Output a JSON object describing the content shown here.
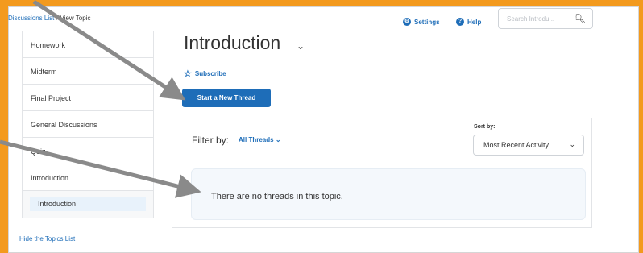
{
  "breadcrumb": {
    "link": "Discussions List",
    "sep": "›",
    "current": "View Topic"
  },
  "header": {
    "settings_label": "Settings",
    "help_label": "Help",
    "search_placeholder": "Search Introdu..."
  },
  "sidebar": {
    "items": [
      {
        "label": "Homework"
      },
      {
        "label": "Midterm"
      },
      {
        "label": "Final Project"
      },
      {
        "label": "General Discussions"
      },
      {
        "label": "Quiz"
      },
      {
        "label": "Introduction"
      }
    ],
    "sub_item": "Introduction",
    "hide_link": "Hide the Topics List"
  },
  "topic": {
    "title": "Introduction",
    "subscribe_label": "Subscribe",
    "start_thread_label": "Start a New Thread"
  },
  "panel": {
    "filter_label": "Filter by:",
    "filter_value": "All Threads",
    "sort_label": "Sort by:",
    "sort_value": "Most Recent Activity",
    "empty_message": "There are no threads in this topic."
  },
  "colors": {
    "background": "#f39a1e",
    "accent": "#1e6db8",
    "arrow": "#8a8a8a"
  }
}
